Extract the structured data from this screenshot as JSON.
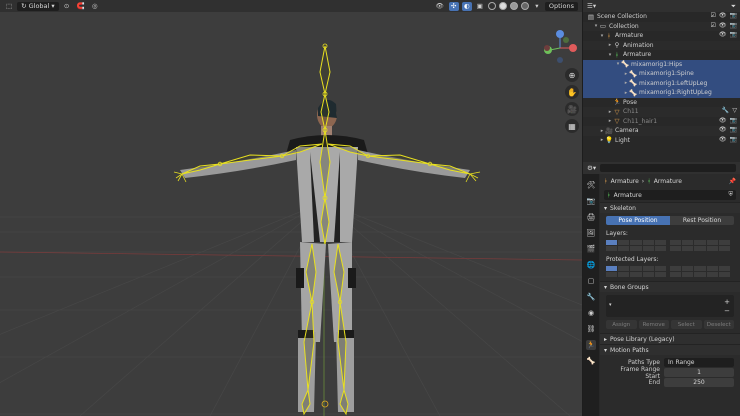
{
  "viewport_header": {
    "orientation": "Global",
    "options_label": "Options"
  },
  "outliner": {
    "header_title": "Scene Collection",
    "rows": [
      {
        "label": "Scene Collection"
      },
      {
        "label": "Collection"
      },
      {
        "label": "Armature"
      },
      {
        "label": "Animation"
      },
      {
        "label": "Armature"
      },
      {
        "label": "mixamorig1:Hips"
      },
      {
        "label": "mixamorig1:Spine"
      },
      {
        "label": "mixamorig1:LeftUpLeg"
      },
      {
        "label": "mixamorig1:RightUpLeg"
      },
      {
        "label": "Pose"
      },
      {
        "label": "Ch11"
      },
      {
        "label": "Ch11_hair1"
      },
      {
        "label": "Camera"
      },
      {
        "label": "Light"
      }
    ]
  },
  "properties": {
    "breadcrumb_object": "Armature",
    "breadcrumb_data": "Armature",
    "name_field": "Armature",
    "skeleton": {
      "title": "Skeleton",
      "pose_position": "Pose Position",
      "rest_position": "Rest Position",
      "layers_label": "Layers:",
      "protected_layers_label": "Protected Layers:"
    },
    "bone_groups": {
      "title": "Bone Groups",
      "assign": "Assign",
      "remove": "Remove",
      "select": "Select",
      "deselect": "Deselect"
    },
    "pose_library": "Pose Library (Legacy)",
    "motion_paths": {
      "title": "Motion Paths",
      "paths_type_label": "Paths Type",
      "paths_type_value": "In Range",
      "frame_range_start_label": "Frame Range Start",
      "frame_range_start_value": "1",
      "end_label": "End",
      "end_value": "250"
    }
  },
  "colors": {
    "accent": "#4772b3",
    "bone": "#e8e020",
    "selection": "#334d80"
  }
}
